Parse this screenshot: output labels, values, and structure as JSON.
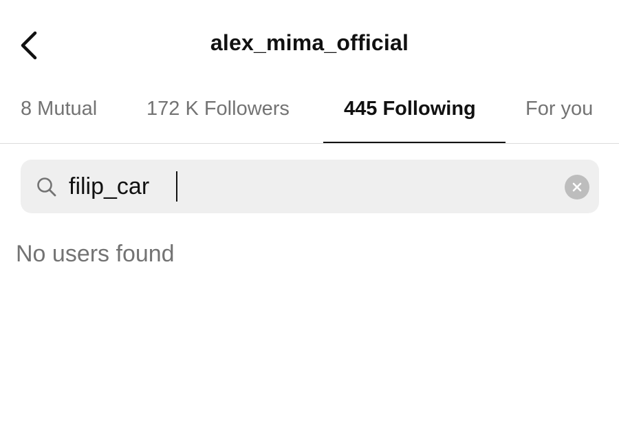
{
  "header": {
    "title": "alex_mima_official",
    "back_icon": "chevron-left-icon"
  },
  "tabs": [
    {
      "label": "8 Mutual",
      "active": false
    },
    {
      "label": "172 K Followers",
      "active": false
    },
    {
      "label": "445 Following",
      "active": true
    },
    {
      "label": "For you",
      "active": false
    }
  ],
  "search": {
    "value": "filip_car",
    "icon": "search-icon",
    "clear_icon": "clear-icon"
  },
  "results": {
    "empty_message": "No users found"
  },
  "colors": {
    "text_primary": "#111111",
    "text_secondary": "#737373",
    "search_bg": "#efefef",
    "clear_bg": "#bdbdbd",
    "divider": "#dcdcdc"
  }
}
